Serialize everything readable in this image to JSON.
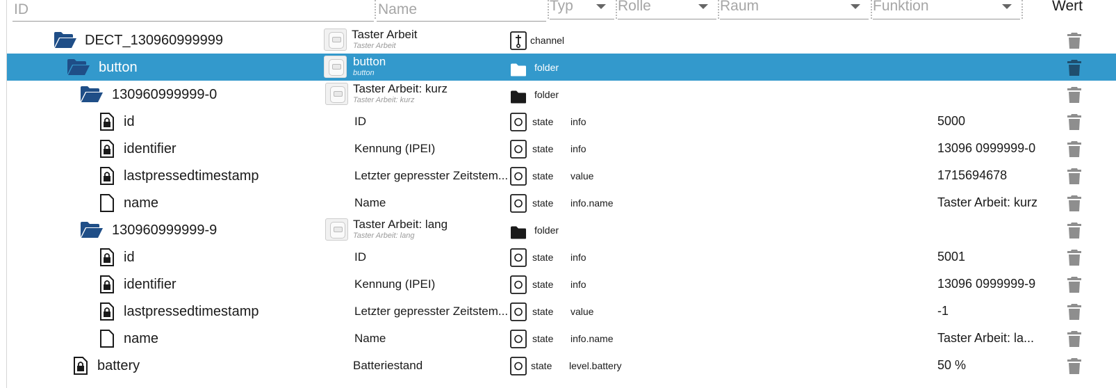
{
  "filters": {
    "id_placeholder": "ID",
    "name_placeholder": "Name",
    "type_label": "Typ",
    "role_label": "Rolle",
    "room_label": "Raum",
    "function_label": "Funktion",
    "value_header": "Wert"
  },
  "rows": [
    {
      "id": "DECT_130960999999",
      "name": "Taster Arbeit",
      "name_sub": "Taster Arbeit",
      "type": "channel",
      "role": "",
      "value": ""
    },
    {
      "id": "button",
      "name": "button",
      "name_sub": "button",
      "type": "folder",
      "role": "",
      "value": ""
    },
    {
      "id": "130960999999-0",
      "name": "Taster Arbeit: kurz",
      "name_sub": "Taster Arbeit: kurz",
      "type": "folder",
      "role": "",
      "value": ""
    },
    {
      "id": "id",
      "name": "ID",
      "type": "state",
      "role": "info",
      "value": "5000"
    },
    {
      "id": "identifier",
      "name": "Kennung (IPEI)",
      "type": "state",
      "role": "info",
      "value": "13096 0999999-0"
    },
    {
      "id": "lastpressedtimestamp",
      "name": "Letzter gepresster Zeitstem...",
      "type": "state",
      "role": "value",
      "value": "1715694678"
    },
    {
      "id": "name",
      "name": "Name",
      "type": "state",
      "role": "info.name",
      "value": "Taster Arbeit: kurz"
    },
    {
      "id": "130960999999-9",
      "name": "Taster Arbeit: lang",
      "name_sub": "Taster Arbeit: lang",
      "type": "folder",
      "role": "",
      "value": ""
    },
    {
      "id": "id",
      "name": "ID",
      "type": "state",
      "role": "info",
      "value": "5001"
    },
    {
      "id": "identifier",
      "name": "Kennung (IPEI)",
      "type": "state",
      "role": "info",
      "value": "13096 0999999-9"
    },
    {
      "id": "lastpressedtimestamp",
      "name": "Letzter gepresster Zeitstem...",
      "type": "state",
      "role": "value",
      "value": "-1"
    },
    {
      "id": "name",
      "name": "Name",
      "type": "state",
      "role": "info.name",
      "value": "Taster Arbeit: la..."
    },
    {
      "id": "battery",
      "name": "Batteriestand",
      "type": "state",
      "role": "level.battery",
      "value": "50 %"
    }
  ],
  "icons": {
    "open_folder": "folder-open-icon",
    "locked_file": "file-lock-icon",
    "file": "file-icon",
    "channel": "channel-icon",
    "state": "state-icon",
    "folder": "folder-icon",
    "trash": "trash-icon"
  },
  "colors": {
    "selected_row": "#3399cc",
    "folder_blue": "#1f4e87",
    "trash_gray": "#8e8e8e"
  }
}
